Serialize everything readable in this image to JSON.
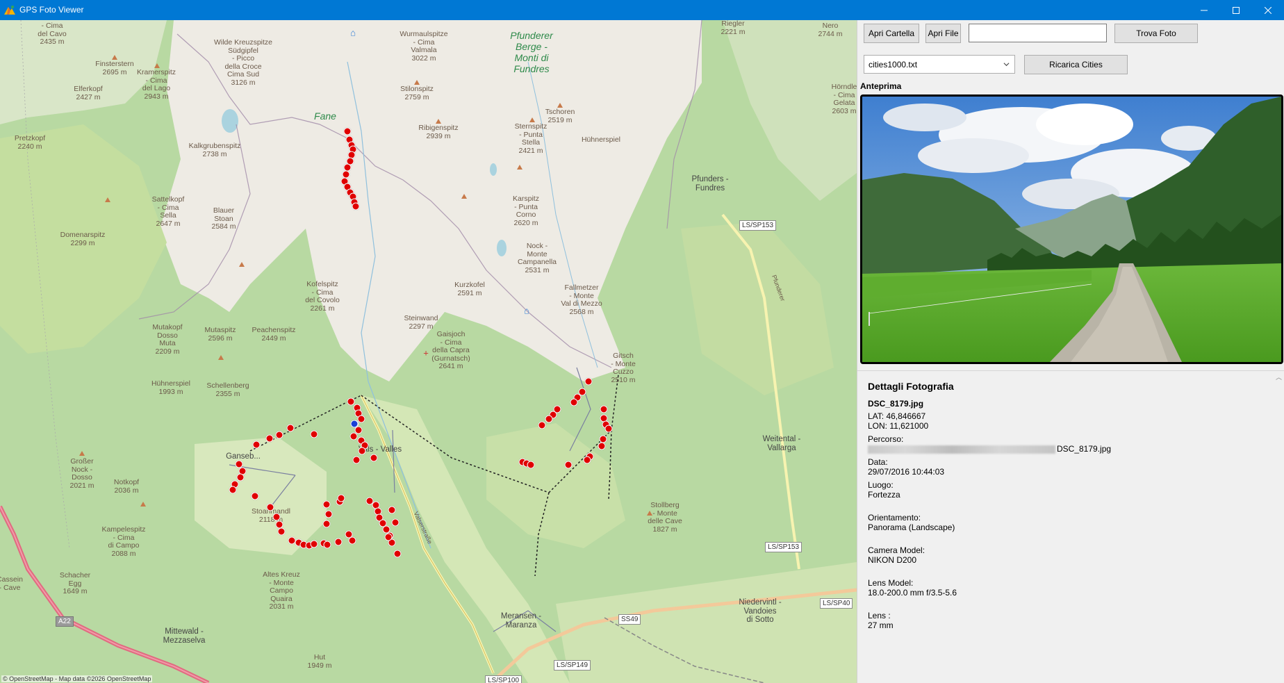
{
  "window": {
    "title": "GPS Foto Viewer",
    "icon": "mountain-app-icon"
  },
  "colors": {
    "titlebar": "#0078d4",
    "marker_red": "#e00000",
    "marker_blue": "#1a3fd6",
    "map_forest": "#a9cf92",
    "map_alpine": "#eeeae3"
  },
  "toolbar": {
    "open_folder_label": "Apri Cartella",
    "open_file_label": "Apri File",
    "search_value": "",
    "find_photo_label": "Trova Foto",
    "cities_selected": "cities1000.txt",
    "reload_cities_label": "Ricarica Cities"
  },
  "preview": {
    "label": "Anteprima"
  },
  "details": {
    "title": "Dettagli Fotografia",
    "filename": "DSC_8179.jpg",
    "lat": "LAT: 46,846667",
    "lon": "LON: 11,621000",
    "path_label": "Percorso:",
    "path_suffix": "DSC_8179.jpg",
    "date_label": "Data:",
    "date_value": "29/07/2016 10:44:03",
    "place_label": "Luogo:",
    "place_value": "Fortezza",
    "orientation_label": "Orientamento:",
    "orientation_value": "Panorama (Landscape)",
    "camera_label": "Camera Model:",
    "camera_value": "NIKON D200",
    "lens_model_label": "Lens Model:",
    "lens_model_value": "18.0-200.0 mm f/3.5-5.6",
    "lens_label": "Lens :",
    "lens_value": "27 mm"
  },
  "map": {
    "attribution": "© OpenStreetMap - Map data ©2026 OpenStreetMap",
    "region_labels": [
      {
        "text": "Pfunderer\nBerge -\nMonti di\nFundres"
      },
      {
        "text": "Fane"
      }
    ],
    "town_labels": [
      {
        "text": "Vals - Valles"
      },
      {
        "text": "Pfunders -\nFundres"
      },
      {
        "text": "Weitental -\nVallarga"
      },
      {
        "text": "Meransen -\nMaranza"
      },
      {
        "text": "Niedervintl -\nVandoies\ndi Sotto"
      },
      {
        "text": "Mittewald -\nMezzaselva"
      },
      {
        "text": "Ganseb..."
      }
    ],
    "peak_labels": [
      {
        "text": "- Cima\ndel Cavo\n2435 m"
      },
      {
        "text": "Wilde Kreuzspitze\nSüdgipfel\n- Picco\ndella Croce\nCima Sud\n3126 m"
      },
      {
        "text": "Wurmaulspitze\n- Cima\nValmala\n3022 m"
      },
      {
        "text": "Riegler\n2221 m"
      },
      {
        "text": "Nero\n2744 m"
      },
      {
        "text": "Finsterstern\n2695 m"
      },
      {
        "text": "Kramerspitz\n- Cima\ndel Lago\n2943 m"
      },
      {
        "text": "Elferkopf\n2427 m"
      },
      {
        "text": "Stilonspitz\n2759 m"
      },
      {
        "text": "Hörndle\n- Cima\nGelata\n2603 m"
      },
      {
        "text": "Tschoren\n2519 m"
      },
      {
        "text": "Ribigenspitz\n2939 m"
      },
      {
        "text": "Sternspitz\n- Punta\nStella\n2421 m"
      },
      {
        "text": "Hühnerspiel"
      },
      {
        "text": "Pretzkopf\n2240 m"
      },
      {
        "text": "Kalkgrubenspitz\n2738 m"
      },
      {
        "text": "Sattelkopf\n- Cima\nSella\n2647 m"
      },
      {
        "text": "Blauer\nStoan\n2584 m"
      },
      {
        "text": "Karspitz\n- Punta\nCorno\n2620 m"
      },
      {
        "text": "Domenarspitz\n2299 m"
      },
      {
        "text": "Nock -\nMonte\nCampanella\n2531 m"
      },
      {
        "text": "Kofelspitz\n- Cima\ndel Covolo\n2261 m"
      },
      {
        "text": "Kurzkofel\n2591 m"
      },
      {
        "text": "Fallmetzer\n- Monte\nVal di Mezzo\n2568 m"
      },
      {
        "text": "Steinwand\n2297 m"
      },
      {
        "text": "Mutakopf\nDosso\nMuta\n2209 m"
      },
      {
        "text": "Mutaspitz\n2596 m"
      },
      {
        "text": "Peachenspitz\n2449 m"
      },
      {
        "text": "Gaisjoch\n- Cima\ndella Capra\n(Gurnatsch)\n2641 m"
      },
      {
        "text": "Gitsch\n- Monte\nCuzzo\n2510 m"
      },
      {
        "text": "Hühnerspiel\n1993 m"
      },
      {
        "text": "Schellenberg\n2355 m"
      },
      {
        "text": "Großer\nNock -\nDosso\n2021 m"
      },
      {
        "text": "Notkopf\n2036 m"
      },
      {
        "text": "Stoanmandl\n2118 m"
      },
      {
        "text": "Stollberg\n- Monte\ndelle Cave\n1827 m"
      },
      {
        "text": "Kampelespitz\n- Cima\ndi Campo\n2088 m"
      },
      {
        "text": "Schacher\nEgg\n1649 m"
      },
      {
        "text": "Altes Kreuz\n- Monte\nCampo\nQuaira\n2031 m"
      },
      {
        "text": "Hut\n1949 m"
      },
      {
        "text": "Cassein\n- Cave"
      }
    ],
    "road_shields": [
      {
        "text": "LS/SP153"
      },
      {
        "text": "LS/SP153"
      },
      {
        "text": "LS/SP40"
      },
      {
        "text": "SS49"
      },
      {
        "text": "LS/SP149"
      },
      {
        "text": "LS/SP100"
      },
      {
        "text": "A22"
      }
    ],
    "road_labels": [
      {
        "text": "Pfunderer"
      },
      {
        "text": "Valserstraße"
      }
    ]
  }
}
